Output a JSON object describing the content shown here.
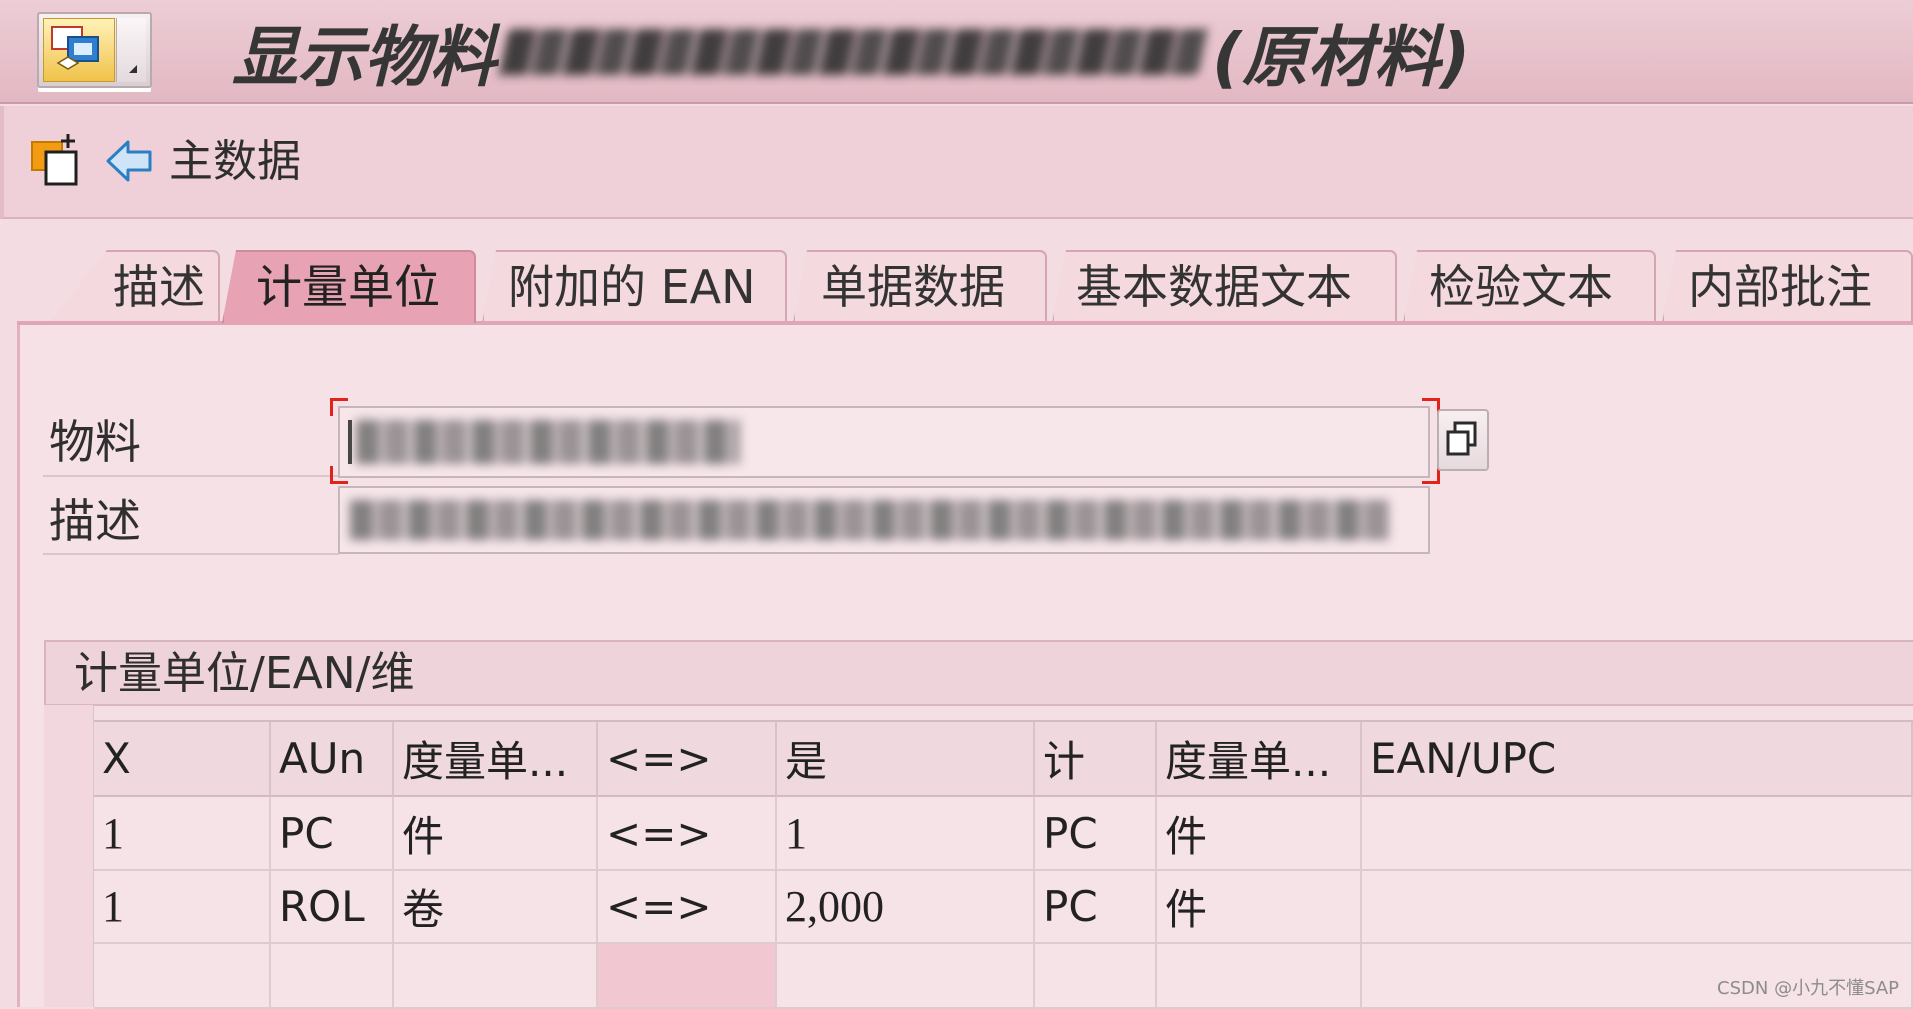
{
  "window": {
    "title_prefix": "显示物料",
    "title_suffix": "(原材料)"
  },
  "toolbar": {
    "main_data_label": "主数据",
    "icons": [
      "other-views-icon",
      "back-arrow-icon"
    ]
  },
  "tabs": [
    {
      "label": "描述",
      "active": false
    },
    {
      "label": "计量单位",
      "active": true
    },
    {
      "label": "附加的 EAN",
      "active": false
    },
    {
      "label": "单据数据",
      "active": false
    },
    {
      "label": "基本数据文本",
      "active": false
    },
    {
      "label": "检验文本",
      "active": false
    },
    {
      "label": "内部批注",
      "active": false
    }
  ],
  "fields": {
    "material_label": "物料",
    "description_label": "描述"
  },
  "group": {
    "title": "计量单位/EAN/维"
  },
  "table": {
    "headers": [
      "X",
      "AUn",
      "度量单...",
      "<=>",
      "是",
      "计",
      "度量单...",
      "EAN/UPC"
    ],
    "rows": [
      [
        "1",
        "PC",
        "件",
        "<=>",
        "1",
        "PC",
        "件",
        ""
      ],
      [
        "1",
        "ROL",
        "卷",
        "<=>",
        "2,000",
        "PC",
        "件",
        ""
      ]
    ]
  },
  "watermark": "CSDN @小九不懂SAP",
  "colors": {
    "title_bar": "#e6c2cb",
    "toolbar": "#efd0d8",
    "background": "#f3dde3",
    "tab_active": "#e7a3b3",
    "tab_inactive": "#f4d9df",
    "focus": "#e2231a"
  }
}
